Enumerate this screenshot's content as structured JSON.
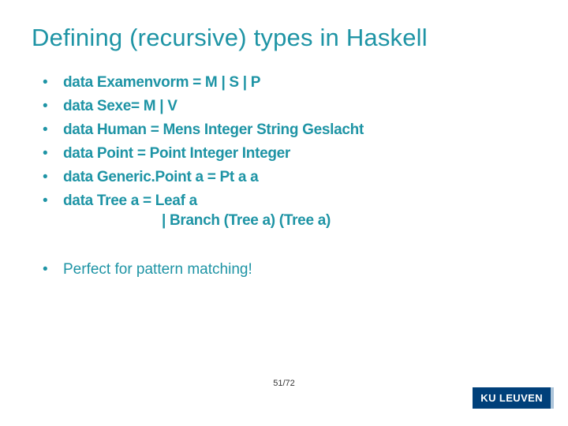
{
  "title": "Defining (recursive) types in Haskell",
  "items": [
    "data Examenvorm = M | S | P",
    "data Sexe= M | V",
    "data Human = Mens Integer String Geslacht",
    "data Point = Point Integer Integer",
    "data Generic.Point a = Pt a a",
    "data Tree a = Leaf a"
  ],
  "tree_continuation": "| Branch (Tree a) (Tree a)",
  "note": "Perfect for pattern matching!",
  "page": "51/72",
  "logo": "KU LEUVEN"
}
